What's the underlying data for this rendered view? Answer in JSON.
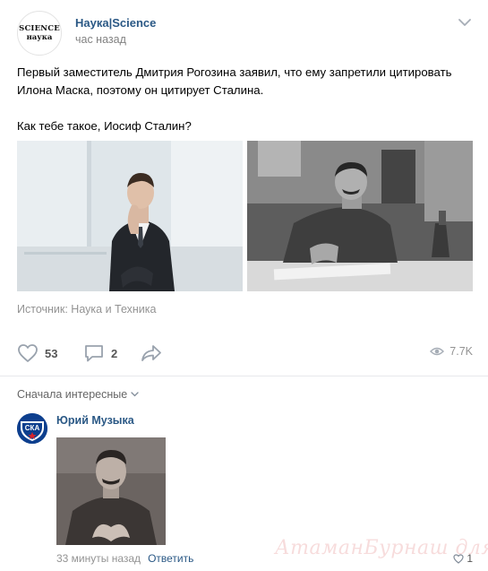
{
  "post": {
    "avatar_line1": "SCIENCE",
    "avatar_line2": "наука",
    "author": "Наука|Science",
    "time": "час назад",
    "text_line1": "Первый заместитель Дмитрия Рогозина заявил, что ему запретили цитировать Илона Маска, поэтому он цитирует Сталина.",
    "text_line2": "Как тебе такое, Иосиф Сталин?",
    "source": "Источник: Наука и Техника",
    "likes": "53",
    "comments": "2",
    "views": "7.7K"
  },
  "comments_section": {
    "sort_label": "Сначала интересные",
    "comment": {
      "avatar_text": "СКА",
      "author": "Юрий Музыка",
      "time": "33 минуты назад",
      "reply_label": "Ответить",
      "likes": "1"
    }
  },
  "watermark": "АтаманБурнаш для ЯП",
  "colors": {
    "link": "#2a5885",
    "secondary": "#939393",
    "divider": "#e7e8ec",
    "icon": "#99a2ad",
    "watermark": "#d23c3c"
  },
  "icons": [
    "chevron-down-icon",
    "heart-icon",
    "comment-icon",
    "share-icon",
    "eye-icon"
  ]
}
